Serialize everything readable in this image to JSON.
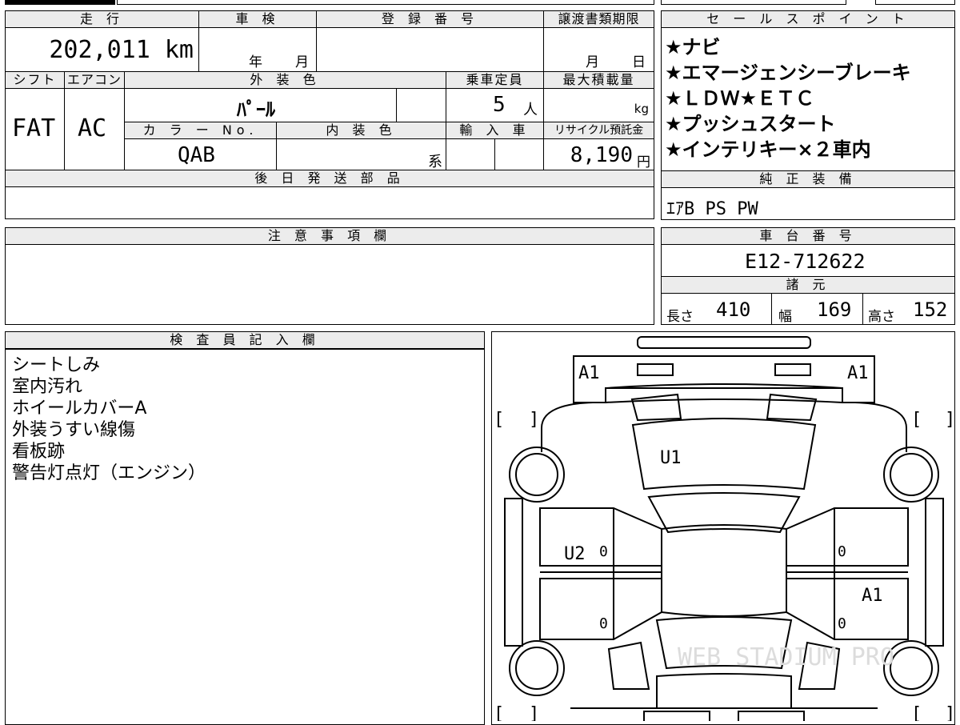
{
  "top_table": {
    "headers": {
      "mileage": "走 行",
      "shaken": "車 検",
      "registration": "登 録 番 号",
      "transfer_deadline": "譲渡書類期限",
      "shift": "シフト",
      "aircon": "エアコン",
      "exterior_color": "外 装 色",
      "capacity": "乗車定員",
      "max_load": "最大積載量",
      "color_no": "カ ラ ー No.",
      "interior_color": "内 装 色",
      "import": "輸 入 車",
      "recycle": "リサイクル預託金"
    },
    "values": {
      "mileage": "202,011 km",
      "shaken_year_unit": "年",
      "shaken_month_unit": "月",
      "transfer_month_unit": "月",
      "transfer_day_unit": "日",
      "shift": "FAT",
      "aircon": "AC",
      "exterior_color": "ﾊﾟｰﾙ",
      "capacity": "5",
      "capacity_unit": "人",
      "max_load_unit": "kg",
      "color_no": "QAB",
      "interior_suffix": "系",
      "recycle": "8,190",
      "recycle_unit": "円"
    }
  },
  "later_parts": {
    "header": "後 日 発 送 部 品",
    "value": ""
  },
  "caution": {
    "header": "注 意 事 項 欄",
    "value": ""
  },
  "sales_points": {
    "header": "セ ー ル ス ポ イ ン ト",
    "items": [
      "★ナビ",
      "★エマージェンシーブレーキ",
      "★ＬＤＷ★ＥＴＣ",
      "★プッシュスタート",
      "★インテリキー×２車内"
    ]
  },
  "standard_equipment": {
    "header": "純 正 装 備",
    "value": "ｴｱB PS PW"
  },
  "chassis": {
    "header": "車 台 番 号",
    "value": "E12-712622"
  },
  "specs": {
    "header": "諸 元",
    "length_label": "長さ",
    "length": "410",
    "width_label": "幅",
    "width": "169",
    "height_label": "高さ",
    "height": "152"
  },
  "inspector": {
    "header": "検 査 員 記 入 欄",
    "lines": [
      "シートしみ",
      "室内汚れ",
      "ホイールカバーA",
      "外装うすい線傷",
      "看板跡",
      "警告灯点灯（エンジン）"
    ]
  },
  "diagram": {
    "marks": {
      "front_left": "A1",
      "front_right": "A1",
      "roof": "U1",
      "left_front_door": "U2",
      "right_rear_door": "A1",
      "zero": "0",
      "bracket_open": "[",
      "bracket_close": "]"
    },
    "watermark": "WEB STADIUM PRO"
  }
}
